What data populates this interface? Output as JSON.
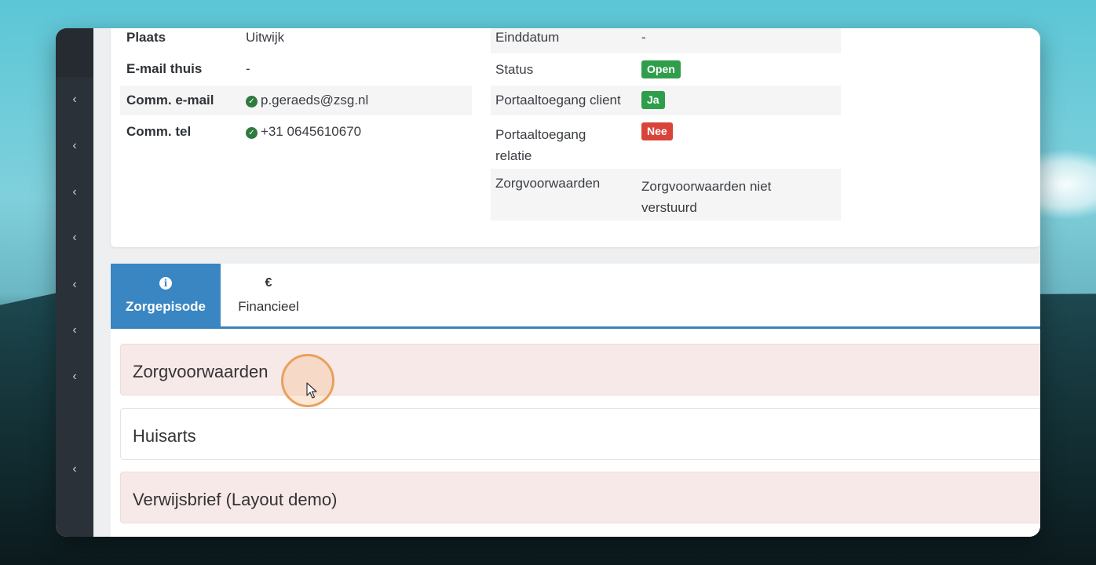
{
  "details_left": [
    {
      "label": "Plaats",
      "value": "Uitwijk",
      "verified": false
    },
    {
      "label": "E-mail thuis",
      "value": "-",
      "verified": false
    },
    {
      "label": "Comm. e-mail",
      "value": "p.geraeds@zsg.nl",
      "verified": true
    },
    {
      "label": "Comm. tel",
      "value": "+31 0645610670",
      "verified": true
    }
  ],
  "details_right": {
    "einddatum": {
      "label": "Einddatum",
      "value": "-"
    },
    "status": {
      "label": "Status",
      "badge": "Open",
      "color": "#2e9e4b"
    },
    "portal_client": {
      "label": "Portaaltoegang client",
      "badge": "Ja",
      "color": "#2e9e4b"
    },
    "portal_relatie": {
      "label_line1": "Portaaltoegang",
      "label_line2": "relatie",
      "badge": "Nee",
      "color": "#d9443a"
    },
    "zorgvoorwaarden": {
      "label": "Zorgvoorwaarden",
      "value_line1": "Zorgvoorwaarden niet",
      "value_line2": "verstuurd"
    }
  },
  "tabs": [
    {
      "icon": "info-icon",
      "glyph": "i",
      "label": "Zorgepisode",
      "active": true
    },
    {
      "icon": "euro-icon",
      "glyph": "€",
      "label": "Financieel",
      "active": false
    }
  ],
  "sections": [
    {
      "title": "Zorgvoorwaarden"
    },
    {
      "title": "Huisarts"
    },
    {
      "title": "Verwijsbrief (Layout demo)"
    }
  ],
  "sidebar": {
    "chevron_glyph": "‹",
    "count": 8
  },
  "colors": {
    "accent": "#3a86c2",
    "sidebar": "#2b3138",
    "section_pink": "#f7e9e8"
  }
}
